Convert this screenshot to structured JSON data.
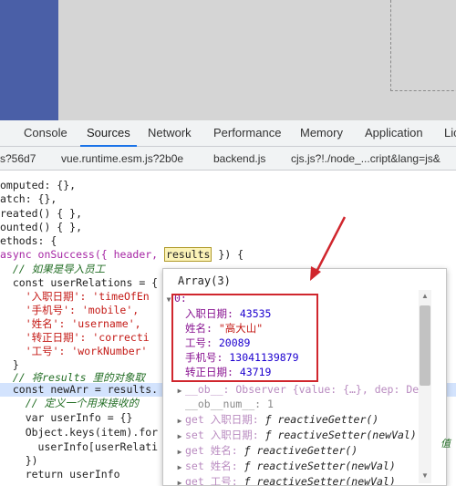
{
  "devtools": {
    "tabs": [
      "Console",
      "Sources",
      "Network",
      "Performance",
      "Memory",
      "Application",
      "Lic"
    ],
    "active_tab": "Sources"
  },
  "files": [
    "s?56d7",
    "vue.runtime.esm.js?2b0e",
    "backend.js",
    "cjs.js?!./node_...cript&lang=js&"
  ],
  "code": {
    "l1": "omputed: {},",
    "l2": "atch: {},",
    "l3": "reated() { },",
    "l4": "ounted() { },",
    "l5": "ethods: {",
    "l6_pre": "async onSuccess({ header, ",
    "l6_token": "results",
    "l6_post": " }) {",
    "l7": "  // 如果是导入员工",
    "l8": "  const userRelations = {",
    "l9": "    '入职日期': 'timeOfEn",
    "l10": "    '手机号': 'mobile',",
    "l11": "    '姓名': 'username',",
    "l12": "    '转正日期': 'correcti",
    "l13": "    '工号': 'workNumber'",
    "l14": "  }",
    "l15": "  // 将results 里的对象取",
    "l16": "  const newArr = results.",
    "l17": "    // 定义一个用来接收的",
    "l18": "    var userInfo = {}",
    "l19": "    Object.keys(item).for",
    "l20": "      userInfo[userRelati",
    "l21": "    })",
    "l22": "    return userInfo"
  },
  "popover": {
    "title": "Array(3)",
    "index_label": "0:",
    "entries": [
      {
        "key": "入职日期",
        "value": "43535"
      },
      {
        "key": "姓名",
        "value": "\"高大山\""
      },
      {
        "key": "工号",
        "value": "20089"
      },
      {
        "key": "手机号",
        "value": "13041139879"
      },
      {
        "key": "转正日期",
        "value": "43719"
      }
    ],
    "ob_row": "__ob__: Observer {value: {…}, dep: De",
    "num_row": "__ob__num__: 1",
    "accessors": [
      {
        "kind": "get",
        "name": "入职日期",
        "fn": "reactiveGetter()"
      },
      {
        "kind": "set",
        "name": "入职日期",
        "fn": "reactiveSetter(newVal)"
      },
      {
        "kind": "get",
        "name": "姓名",
        "fn": "reactiveGetter()"
      },
      {
        "kind": "set",
        "name": "姓名",
        "fn": "reactiveSetter(newVal)"
      },
      {
        "kind": "get",
        "name": "工号",
        "fn": "reactiveSetter(newVal)"
      }
    ],
    "fn_symbol": "ƒ",
    "trailing_hint": "值"
  },
  "colors": {
    "annotation_red": "#d0262d",
    "active_tab_underline": "#1a73e8"
  }
}
